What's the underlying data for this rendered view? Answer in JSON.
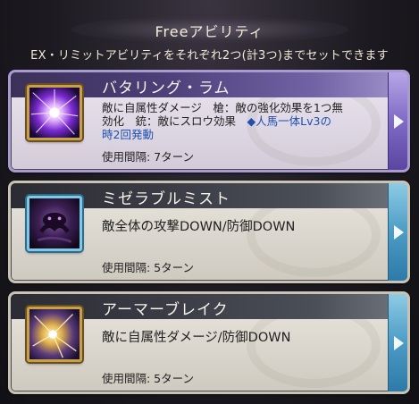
{
  "header": {
    "title": "Freeアビリティ",
    "subtitle": "EX・リミットアビリティをそれぞれ2つ(計3つ)までセットできます"
  },
  "abilities": [
    {
      "name": "バタリング・ラム",
      "icon": "purple-burst-icon",
      "selected": true,
      "desc_lines": [
        "敵に自属性ダメージ　槍：敵の強化効果を1つ無",
        "効化　銃：敵にスロウ効果　",
        "◆人馬一体Lv3の",
        "時2回発動"
      ],
      "interval": "使用間隔: 7ターン"
    },
    {
      "name": "ミゼラブルミスト",
      "icon": "dark-mist-icon",
      "selected": false,
      "desc": "敵全体の攻撃DOWN/防御DOWN",
      "interval": "使用間隔: 5ターン"
    },
    {
      "name": "アーマーブレイク",
      "icon": "armor-break-icon",
      "selected": false,
      "desc": "敵に自属性ダメージ/防御DOWN",
      "interval": "使用間隔: 5ターン"
    }
  ],
  "colors": {
    "selected_accent": "#7f6bc6",
    "tab_accent": "#4b9cc6",
    "highlight_text": "#1f4fb0"
  }
}
